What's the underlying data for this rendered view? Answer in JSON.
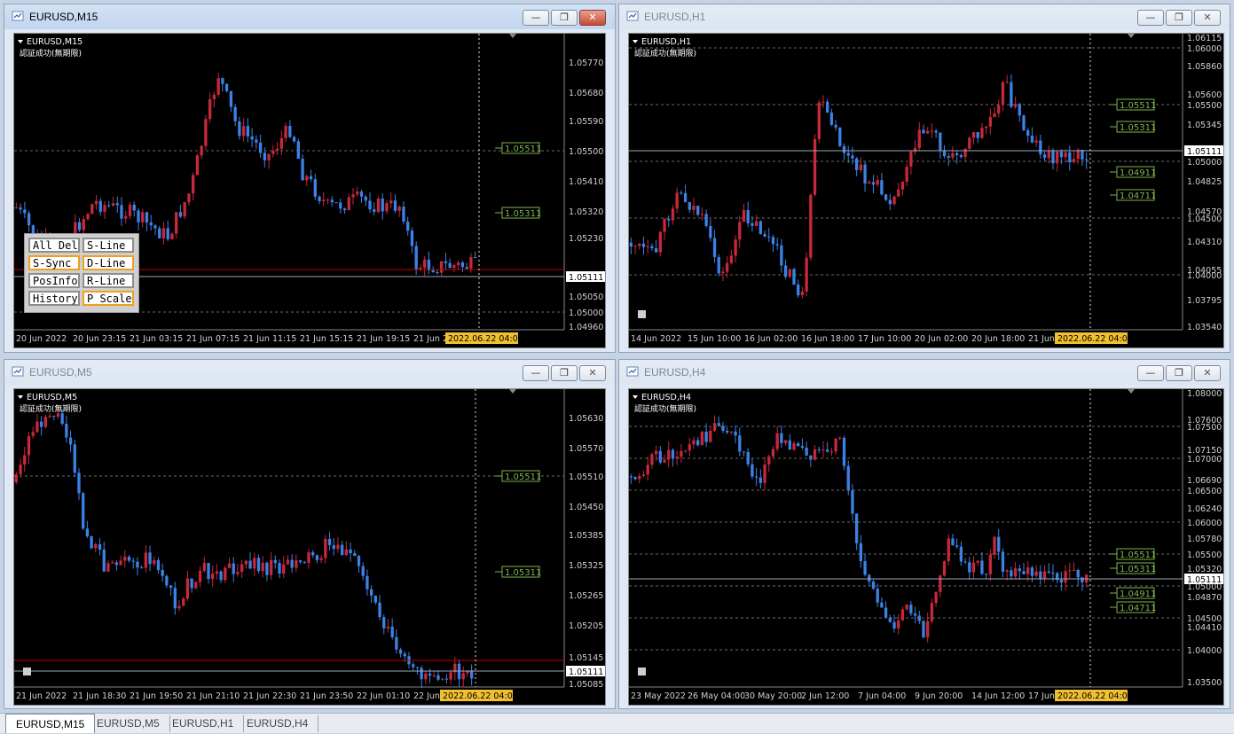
{
  "windows": [
    {
      "id": "m15",
      "title": "EURUSD,M15",
      "symbol": "EURUSD,M15",
      "subtitle": "認証成功(無期限)",
      "state": "active",
      "price_labels": [
        "1.05770",
        "1.05680",
        "1.05590",
        "1.05500",
        "1.05410",
        "1.05320",
        "1.05230",
        "1.05111",
        "1.05050",
        "1.05000",
        "1.04960"
      ],
      "hlines": [
        {
          "text": "1.05511"
        },
        {
          "text": "1.05311"
        }
      ],
      "current_price": "1.05111",
      "red_price": "",
      "time_labels": [
        "20 Jun 2022",
        "20 Jun 23:15",
        "21 Jun 03:15",
        "21 Jun 07:15",
        "21 Jun 11:15",
        "21 Jun 15:15",
        "21 Jun 19:15",
        "21 Jun 2"
      ],
      "time_highlight": "2022.06.22 04:00",
      "buttons": [
        [
          "All Del",
          "S-Line"
        ],
        [
          "S-Sync",
          "D-Line"
        ],
        [
          "PosInfo",
          "R-Line"
        ],
        [
          "History",
          "P Scale"
        ]
      ]
    },
    {
      "id": "h1",
      "title": "EURUSD,H1",
      "symbol": "EURUSD,H1",
      "subtitle": "認証成功(無期限)",
      "state": "inactive",
      "price_labels": [
        "1.06115",
        "1.06000",
        "1.05860",
        "1.05600",
        "1.05500",
        "1.05345",
        "1.05111",
        "1.05000",
        "1.04825",
        "1.04570",
        "1.04500",
        "1.04310",
        "1.04055",
        "1.04000",
        "1.03795",
        "1.03540"
      ],
      "hlines": [
        {
          "text": "1.05511"
        },
        {
          "text": "1.05311"
        },
        {
          "text": "1.04911"
        },
        {
          "text": "1.04711"
        }
      ],
      "current_price": "1.05111",
      "time_labels": [
        "14 Jun 2022",
        "15 Jun 10:00",
        "16 Jun 02:00",
        "16 Jun 18:00",
        "17 Jun 10:00",
        "20 Jun 02:00",
        "20 Jun 18:00",
        "21 Jun 1"
      ],
      "time_highlight": "2022.06.22 04:00"
    },
    {
      "id": "m5",
      "title": "EURUSD,M5",
      "symbol": "EURUSD,M5",
      "subtitle": "認証成功(無期限)",
      "state": "inactive",
      "price_labels": [
        "1.05630",
        "1.05570",
        "1.05510",
        "1.05450",
        "1.05385",
        "1.05325",
        "1.05265",
        "1.05205",
        "1.05145",
        "1.05111",
        "1.05085"
      ],
      "hlines": [
        {
          "text": "1.05511"
        },
        {
          "text": "1.05311"
        }
      ],
      "current_price": "1.05111",
      "red_price": "1.05122",
      "time_labels": [
        "21 Jun 2022",
        "21 Jun 18:30",
        "21 Jun 19:50",
        "21 Jun 21:10",
        "21 Jun 22:30",
        "21 Jun 23:50",
        "22 Jun 01:10",
        "22 Jun"
      ],
      "time_highlight": "2022.06.22 04:00"
    },
    {
      "id": "h4",
      "title": "EURUSD,H4",
      "symbol": "EURUSD,H4",
      "subtitle": "認証成功(無期限)",
      "state": "inactive",
      "price_labels": [
        "1.08000",
        "1.07600",
        "1.07500",
        "1.07150",
        "1.07000",
        "1.06690",
        "1.06500",
        "1.06240",
        "1.06000",
        "1.05780",
        "1.05500",
        "1.05320",
        "1.05111",
        "1.05000",
        "1.04870",
        "1.04500",
        "1.04410",
        "1.04000",
        "1.03500"
      ],
      "hlines": [
        {
          "text": "1.05511"
        },
        {
          "text": "1.05311"
        },
        {
          "text": "1.04911"
        },
        {
          "text": "1.04711"
        }
      ],
      "current_price": "1.05111",
      "time_labels": [
        "23 May 2022",
        "26 May 04:00",
        "30 May 20:00",
        "2 Jun 12:00",
        "7 Jun 04:00",
        "9 Jun 20:00",
        "14 Jun 12:00",
        "17 Jun"
      ],
      "time_highlight": "2022.06.22 04:00"
    }
  ],
  "tabs": [
    "EURUSD,M15",
    "EURUSD,M5",
    "EURUSD,H1",
    "EURUSD,H4"
  ],
  "active_tab": 0,
  "colors": {
    "bull": "#c8283c",
    "bear": "#3c82e6",
    "grid": "#6a6a6a",
    "hline": "#7fb34d",
    "crosshair": "#e0e0e0",
    "highlight": "#f0c030"
  }
}
